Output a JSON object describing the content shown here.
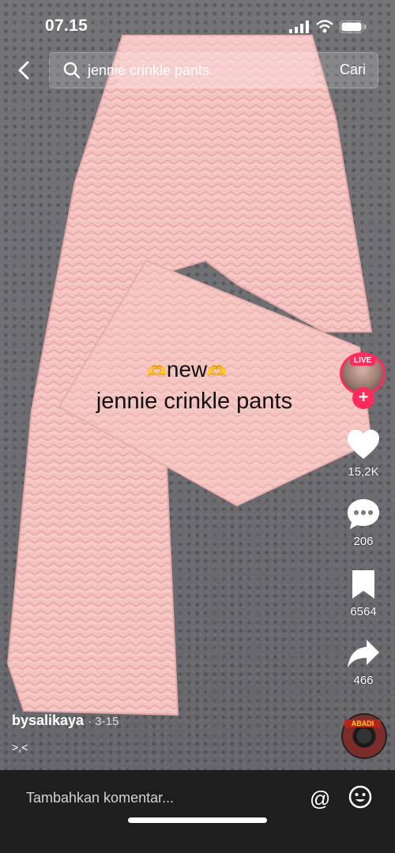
{
  "status_bar": {
    "time": "07.15"
  },
  "search": {
    "query": "jennie crinkle pants",
    "submit_label": "Cari"
  },
  "video_caption": {
    "line1": "new",
    "line2": "jennie crinkle pants"
  },
  "live_badge": "LIVE",
  "actions": {
    "likes": "15,2K",
    "comments": "206",
    "saves": "6564",
    "shares": "466"
  },
  "author": {
    "username": "bysalikaya",
    "date": "3-15",
    "description": ">,<"
  },
  "comment_input": {
    "placeholder": "Tambahkan komentar..."
  },
  "music_disc_label": "ABADI",
  "colors": {
    "pants": "#f4c3c1",
    "accent": "#ff2b5c",
    "comment_bar": "#1e1e1e"
  }
}
